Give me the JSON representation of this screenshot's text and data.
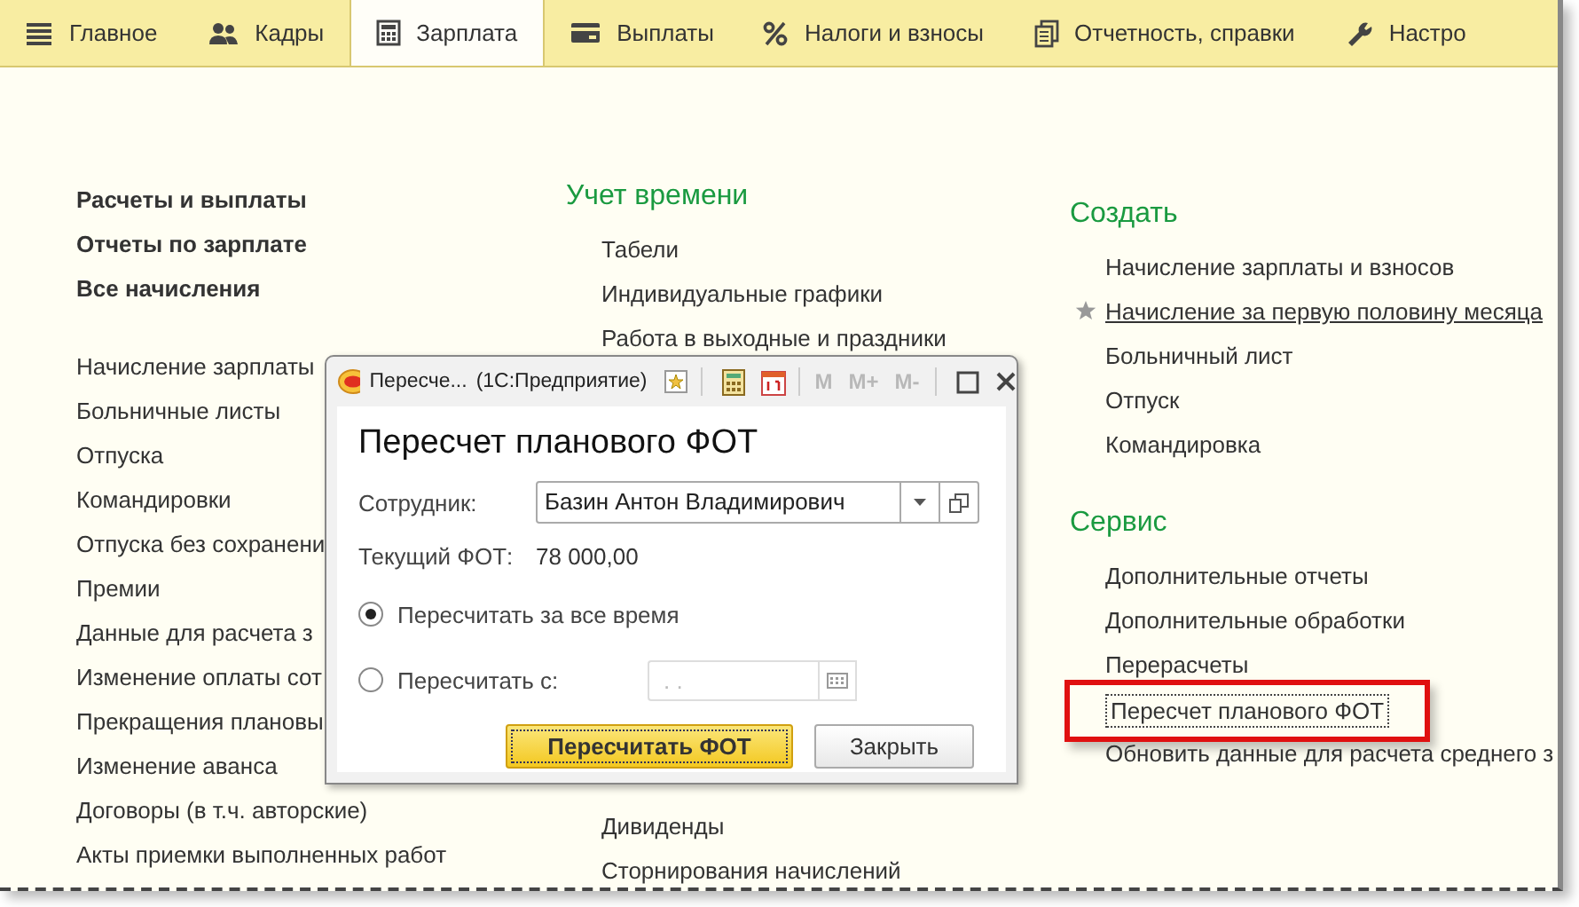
{
  "tabs": [
    {
      "label": "Главное",
      "kind": "menu",
      "selected": false
    },
    {
      "label": "Кадры",
      "kind": "people",
      "selected": false
    },
    {
      "label": "Зарплата",
      "kind": "calculator",
      "selected": true
    },
    {
      "label": "Выплаты",
      "kind": "card",
      "selected": false
    },
    {
      "label": "Налоги и взносы",
      "kind": "percent",
      "selected": false
    },
    {
      "label": "Отчетность, справки",
      "kind": "documents",
      "selected": false
    },
    {
      "label": "Настро",
      "kind": "wrench",
      "selected": false
    }
  ],
  "left": {
    "bold_links": [
      "Расчеты и выплаты",
      "Отчеты по зарплате",
      "Все начисления"
    ],
    "links": [
      "Начисление зарплаты",
      "Больничные листы",
      "Отпуска",
      "Командировки",
      "Отпуска без сохранени",
      "Премии",
      "Данные для расчета з",
      "Изменение оплаты сот",
      "Прекращения плановы",
      "Изменение аванса",
      "Договоры (в т.ч. авторские)",
      "Акты приемки выполненных работ"
    ]
  },
  "middle": {
    "title": "Учет времени",
    "items": [
      "Табели",
      "Индивидуальные графики",
      "Работа в выходные и праздники"
    ],
    "items_below_dialog": [
      "Дивиденды",
      "Сторнирования начислений"
    ]
  },
  "right": [
    {
      "title": "Создать",
      "items": [
        {
          "label": "Начисление зарплаты и взносов",
          "favorite": false,
          "highlighted": false
        },
        {
          "label": "Начисление за первую половину месяца",
          "favorite": true,
          "highlighted": false
        },
        {
          "label": "Больничный лист",
          "favorite": false,
          "highlighted": false
        },
        {
          "label": "Отпуск",
          "favorite": false,
          "highlighted": false
        },
        {
          "label": "Командировка",
          "favorite": false,
          "highlighted": false
        }
      ]
    },
    {
      "title": "Сервис",
      "items": [
        {
          "label": "Дополнительные отчеты",
          "favorite": false,
          "highlighted": false
        },
        {
          "label": "Дополнительные обработки",
          "favorite": false,
          "highlighted": false
        },
        {
          "label": "Перерасчеты",
          "favorite": false,
          "highlighted": false
        },
        {
          "label": "Пересчет планового ФОТ",
          "favorite": false,
          "highlighted": true
        },
        {
          "label": "Обновить данные для расчета среднего з",
          "favorite": false,
          "highlighted": false
        }
      ]
    }
  ],
  "dialog": {
    "title": "Пересче...",
    "app": "(1С:Предприятие)",
    "memory_buttons": [
      {
        "label": "M",
        "disabled": true
      },
      {
        "label": "M+",
        "disabled": true
      },
      {
        "label": "M-",
        "disabled": true
      }
    ],
    "heading": "Пересчет планового ФОТ",
    "employee_label": "Сотрудник:",
    "employee_value": "Базин Антон Владимирович",
    "fot_label": "Текущий ФОТ:",
    "fot_value": "78 000,00",
    "options": [
      {
        "label": "Пересчитать за все время",
        "selected": true
      },
      {
        "label": "Пересчитать с:",
        "selected": false
      }
    ],
    "date_placeholder": ". .",
    "buttons": [
      {
        "label": "Пересчитать ФОТ",
        "default": true
      },
      {
        "label": "Закрыть",
        "default": false
      }
    ]
  }
}
